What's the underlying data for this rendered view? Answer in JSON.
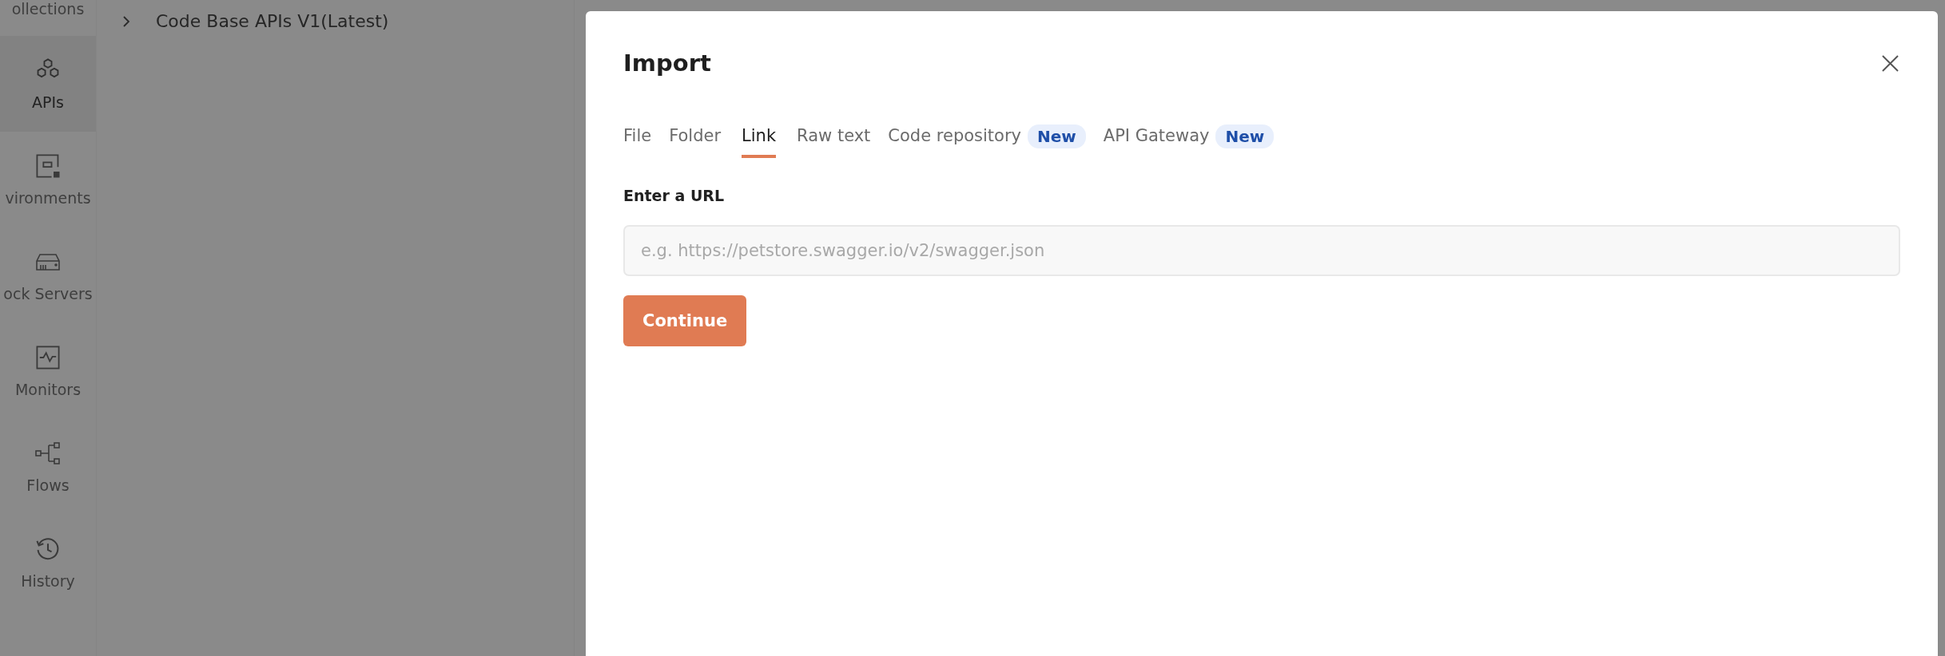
{
  "sidebar": {
    "items": [
      {
        "label": "ollections",
        "selected": false
      },
      {
        "label": "APIs",
        "selected": true
      },
      {
        "label": "vironments",
        "selected": false
      },
      {
        "label": "ock Servers",
        "selected": false
      },
      {
        "label": "Monitors",
        "selected": false
      },
      {
        "label": "Flows",
        "selected": false
      },
      {
        "label": "History",
        "selected": false
      }
    ]
  },
  "tree": {
    "items": [
      {
        "label": "Code Base APIs V1(Latest)",
        "expanded": false
      }
    ]
  },
  "dialog": {
    "title": "Import",
    "tabs": [
      {
        "label": "File",
        "selected": false
      },
      {
        "label": "Folder",
        "selected": false
      },
      {
        "label": "Link",
        "selected": true
      },
      {
        "label": "Raw text",
        "selected": false
      },
      {
        "label": "Code repository",
        "selected": false,
        "badge": "New"
      },
      {
        "label": "API Gateway",
        "selected": false,
        "badge": "New"
      }
    ],
    "url_label": "Enter a URL",
    "url_field": {
      "placeholder": "e.g. https://petstore.swagger.io/v2/swagger.json"
    },
    "buttons": [
      "Continue"
    ]
  }
}
